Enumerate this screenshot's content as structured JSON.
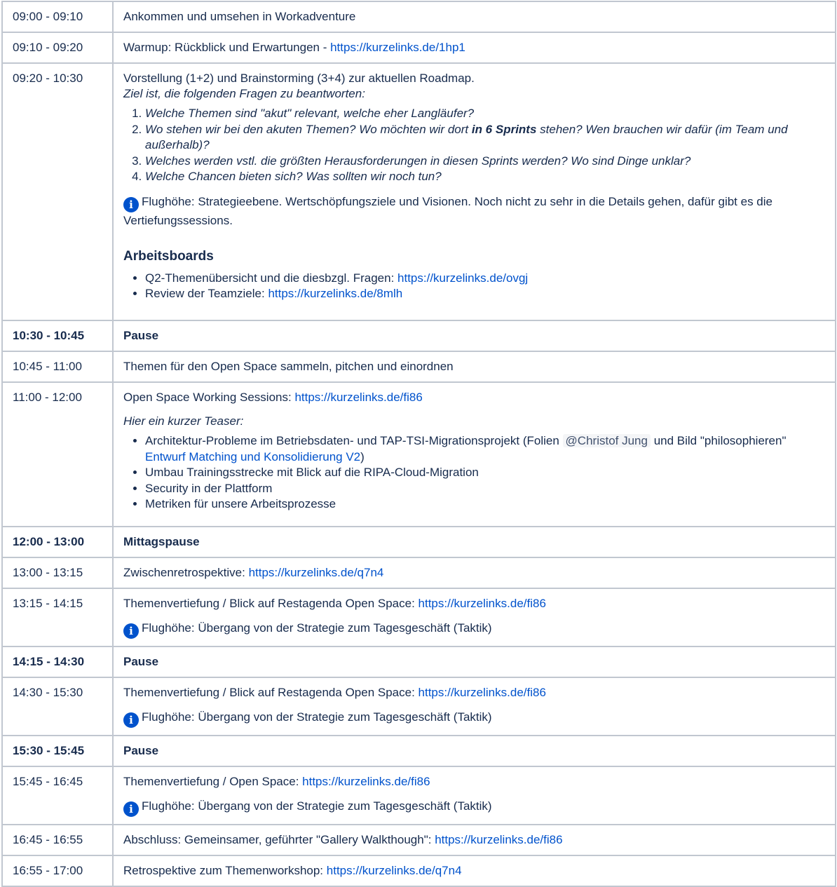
{
  "link_color": "#0052cc",
  "rows": [
    {
      "time": "09:00 - 09:10",
      "text": "Ankommen und umsehen in Workadventure"
    },
    {
      "time": "09:10 - 09:20",
      "text": "Warmup: Rückblick und Erwartungen - ",
      "link": "https://kurzelinks.de/1hp1"
    },
    {
      "time": "09:20 - 10:30",
      "intro": "Vorstellung (1+2) und Brainstorming (3+4) zur aktuellen Roadmap.",
      "goal": "Ziel ist, die folgenden Fragen zu beantworten:",
      "questions": [
        "Welche Themen sind \"akut\" relevant, welche eher Langläufer?",
        {
          "pre": "Wo stehen wir bei den akuten Themen? Wo möchten wir dort ",
          "bold": "in 6 Sprints",
          "post": " stehen? Wen brauchen wir dafür (im Team und außerhalb)?"
        },
        "Welches werden vstl. die größten Herausforderungen in diesen Sprints werden? Wo sind Dinge unklar?",
        "Welche Chancen bieten sich? Was sollten wir noch tun?"
      ],
      "info": "Flughöhe: Strategieebene. Wertschöpfungsziele und Visionen. Noch nicht zu sehr in die Details gehen, dafür gibt es die Vertiefungssessions.",
      "boards_heading": "Arbeitsboards",
      "boards": [
        {
          "text": "Q2-Themenübersicht und die diesbzgl. Fragen: ",
          "link": "https://kurzelinks.de/ovgj"
        },
        {
          "text": "Review der Teamziele: ",
          "link": "https://kurzelinks.de/8mlh"
        }
      ]
    },
    {
      "time": "10:30 - 10:45",
      "text": "Pause"
    },
    {
      "time": "10:45 - 11:00",
      "text": "Themen für den Open Space sammeln, pitchen und einordnen"
    },
    {
      "time": "11:00 - 12:00",
      "text": "Open Space Working Sessions: ",
      "link": "https://kurzelinks.de/fi86",
      "teaser": "Hier ein kurzer Teaser:",
      "item1_pre": "Architektur-Probleme im Betriebsdaten- und TAP-TSI-Migrationsprojekt (Folien ",
      "item1_mention": "@Christof Jung",
      "item1_mid": "  und Bild \"philosophieren\" ",
      "item1_link": "Entwurf Matching und Konsolidierung V2",
      "item1_post": ")",
      "items": [
        "Umbau Trainingsstrecke mit Blick auf die RIPA-Cloud-Migration",
        "Security in der Plattform",
        "Metriken für unsere Arbeitsprozesse"
      ]
    },
    {
      "time": "12:00 - 13:00",
      "text": "Mittagspause"
    },
    {
      "time": "13:00 - 13:15",
      "text": "Zwischenretrospektive: ",
      "link": "https://kurzelinks.de/q7n4"
    },
    {
      "time": "13:15 - 14:15",
      "text": "Themenvertiefung / Blick auf Restagenda Open Space: ",
      "link": "https://kurzelinks.de/fi86",
      "info": "Flughöhe: Übergang von der Strategie zum Tagesgeschäft (Taktik)"
    },
    {
      "time": "14:15 - 14:30",
      "text": "Pause"
    },
    {
      "time": "14:30 - 15:30",
      "text": "Themenvertiefung / Blick auf Restagenda Open Space: ",
      "link": "https://kurzelinks.de/fi86",
      "info": "Flughöhe: Übergang von der Strategie zum Tagesgeschäft (Taktik)"
    },
    {
      "time": "15:30 - 15:45",
      "text": "Pause"
    },
    {
      "time": "15:45 - 16:45",
      "text": "Themenvertiefung / Open Space: ",
      "link": "https://kurzelinks.de/fi86",
      "info": "Flughöhe: Übergang von der Strategie zum Tagesgeschäft (Taktik)"
    },
    {
      "time": "16:45 - 16:55",
      "text": "Abschluss: Gemeinsamer, geführter \"Gallery Walkthough\": ",
      "link": "https://kurzelinks.de/fi86"
    },
    {
      "time": "16:55 - 17:00",
      "text": "Retrospektive zum Themenworkshop: ",
      "link": "https://kurzelinks.de/q7n4"
    }
  ]
}
